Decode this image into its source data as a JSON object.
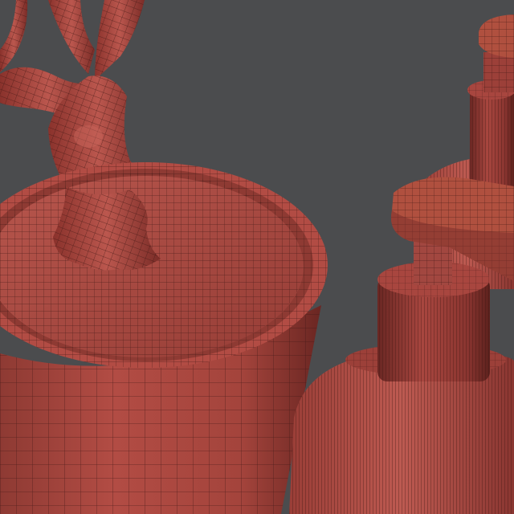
{
  "viewport": {
    "background_color": "#4b4c4e"
  },
  "scene": {
    "mesh_color": "#a8463f",
    "mesh_highlight": "#c8635a",
    "mesh_shadow": "#6e2824",
    "wire_color": "#3b1512",
    "objects": [
      {
        "name": "tree-trunk",
        "kind": "organic-branch"
      },
      {
        "name": "plant-pot",
        "kind": "cylinder-pot-with-soil"
      },
      {
        "name": "pump-bottle-back",
        "kind": "pump-dispenser"
      },
      {
        "name": "pump-bottle-front",
        "kind": "pump-dispenser"
      }
    ]
  }
}
